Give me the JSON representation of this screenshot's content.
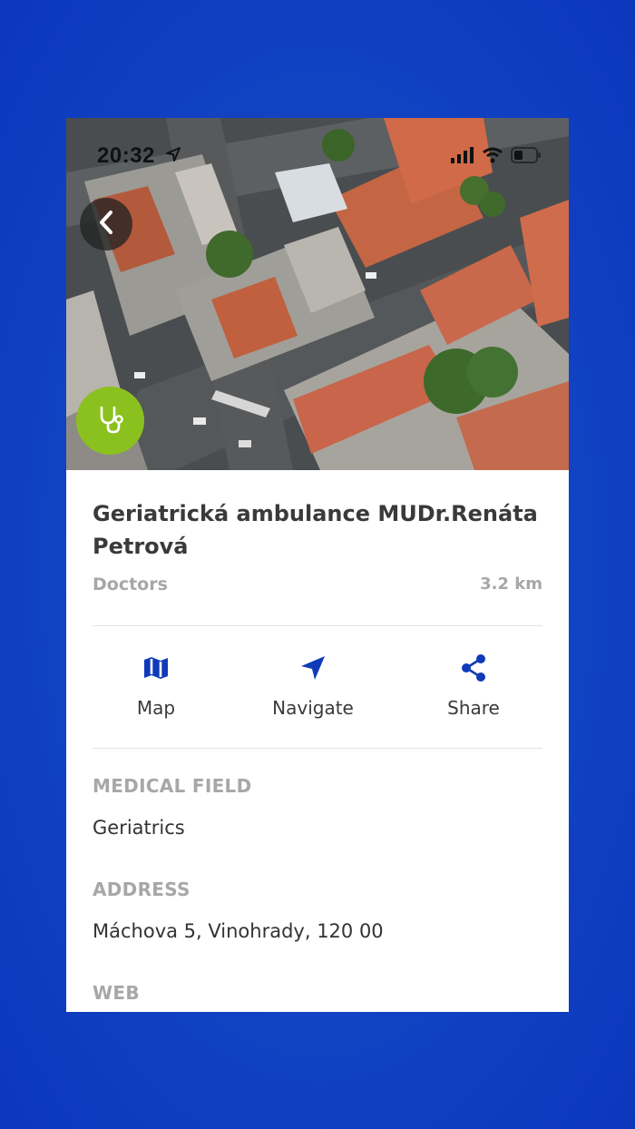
{
  "colors": {
    "background": "#1346c4",
    "accent": "#0f3bb8",
    "badge": "#8bc11f",
    "title": "#3a3a3c",
    "muted": "#a7a7a7"
  },
  "status_bar": {
    "time": "20:32",
    "icons": [
      "location-arrow-icon",
      "signal-icon",
      "wifi-icon",
      "battery-icon"
    ]
  },
  "hero": {
    "back_icon": "chevron-left-icon",
    "category_icon": "stethoscope-icon"
  },
  "place": {
    "title": "Geriatrická ambulance MUDr.Renáta Petrová",
    "category": "Doctors",
    "distance": "3.2 km"
  },
  "actions": [
    {
      "label": "Map",
      "icon": "map-icon"
    },
    {
      "label": "Navigate",
      "icon": "navigate-arrow-icon"
    },
    {
      "label": "Share",
      "icon": "share-icon"
    }
  ],
  "sections": {
    "medical_field": {
      "label": "MEDICAL FIELD",
      "value": "Geriatrics"
    },
    "address": {
      "label": "ADDRESS",
      "value": "Máchova 5, Vinohrady, 120 00"
    },
    "web": {
      "label": "WEB"
    }
  }
}
